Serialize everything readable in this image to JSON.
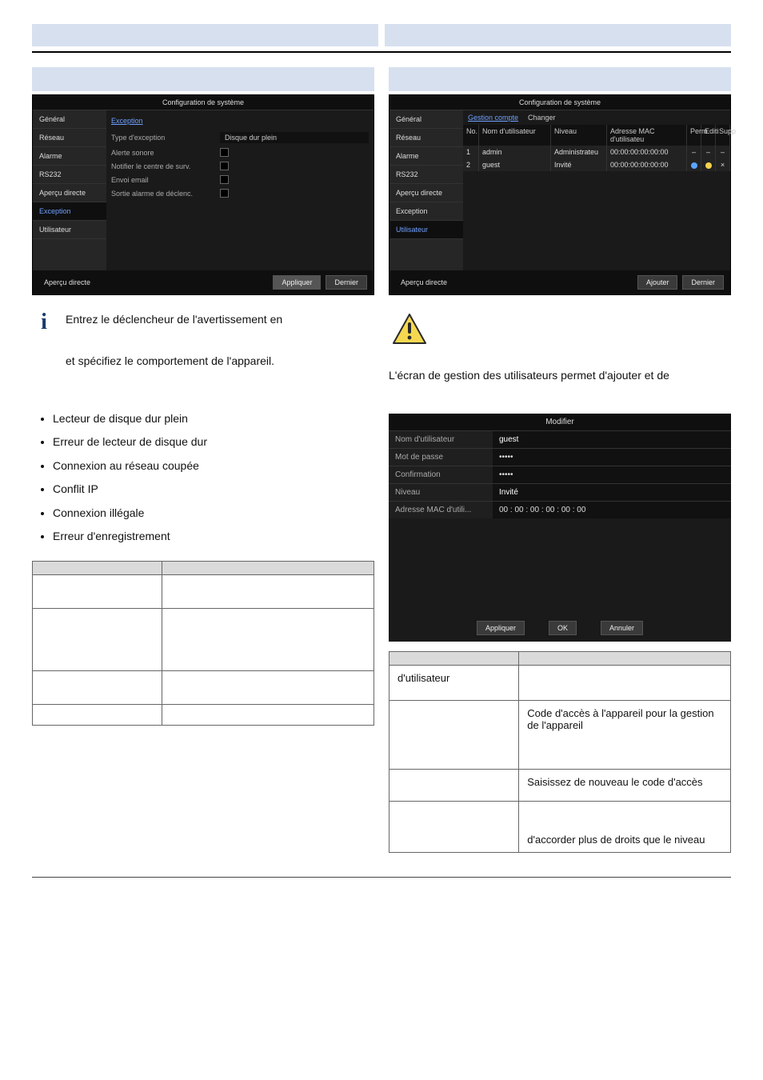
{
  "headings": {
    "left": "",
    "right": ""
  },
  "config_panel_title": "Configuration de système",
  "side_menu": [
    "Général",
    "Réseau",
    "Alarme",
    "RS232",
    "Aperçu directe",
    "Exception",
    "Utilisateur"
  ],
  "exception_panel": {
    "tab": "Exception",
    "rows": [
      {
        "label": "Type d'exception",
        "value": "Disque dur plein"
      },
      {
        "label": "Alerte sonore",
        "checkbox": true
      },
      {
        "label": "Notifier le centre de surv.",
        "checkbox": true
      },
      {
        "label": "Envoi email",
        "checkbox": true
      },
      {
        "label": "Sortie alarme de déclenc.",
        "checkbox": true
      }
    ],
    "footer_label": "Aperçu directe",
    "apply": "Appliquer",
    "close": "Dernier"
  },
  "user_panel": {
    "tabs": [
      "Gestion compte",
      "Changer"
    ],
    "headers": {
      "no": "No.",
      "name": "Nom d'utilisateur",
      "niveau": "Niveau",
      "mac": "Adresse MAC d'utilisateu",
      "perm": "Perm",
      "edit": "Editi",
      "supp": "Supp"
    },
    "rows": [
      {
        "no": "1",
        "name": "admin",
        "niveau": "Administrateu",
        "mac": "00:00:00:00:00:00",
        "perm": "-",
        "edit": "-",
        "supp": "-"
      },
      {
        "no": "2",
        "name": "guest",
        "niveau": "Invité",
        "mac": "00:00:00:00:00:00",
        "perm": "dot",
        "edit": "dot",
        "supp": "x"
      }
    ],
    "footer_label": "Aperçu directe",
    "add": "Ajouter",
    "close": "Dernier"
  },
  "info_text_1a": "Entrez le déclencheur de l'avertissement en",
  "info_text_1b": "et spécifiez le comportement de l'appareil.",
  "user_screen_text": "L'écran de gestion des utilisateurs permet d'ajouter et de",
  "bullets": [
    "Lecteur de disque dur plein",
    "Erreur de lecteur de disque dur",
    "Connexion au réseau coupée",
    "Conflit IP",
    "Connexion illégale",
    "Erreur d'enregistrement"
  ],
  "left_table": {
    "rows": [
      {
        "l": "",
        "r": ""
      },
      {
        "l": "",
        "r": ""
      },
      {
        "l": "",
        "r": ""
      },
      {
        "l": "",
        "r": ""
      },
      {
        "l": "",
        "r": ""
      }
    ]
  },
  "modify_dlg": {
    "title": "Modifier",
    "rows": [
      {
        "label": "Nom d'utilisateur",
        "value": "guest"
      },
      {
        "label": "Mot de passe",
        "value": "•••••"
      },
      {
        "label": "Confirmation",
        "value": "•••••"
      },
      {
        "label": "Niveau",
        "value": "Invité"
      },
      {
        "label": "Adresse MAC d'utili...",
        "value": "00  : 00  : 00  : 00  : 00  : 00"
      }
    ],
    "apply": "Appliquer",
    "ok": "OK",
    "cancel": "Annuler"
  },
  "right_table": {
    "rows": [
      {
        "l": "",
        "r": ""
      },
      {
        "l": "d'utilisateur",
        "r": ""
      },
      {
        "l": "",
        "r": "Code d'accès à l'appareil pour la gestion de l'appareil"
      },
      {
        "l": "",
        "r": "Saisissez de nouveau le code d'accès"
      },
      {
        "l": "",
        "r": "d'accorder plus de droits que le niveau"
      }
    ]
  }
}
